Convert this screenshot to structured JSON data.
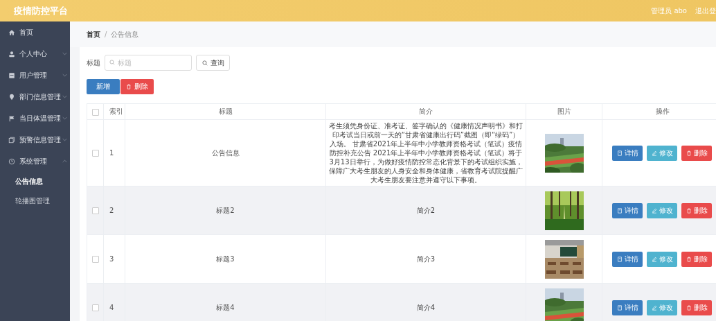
{
  "header": {
    "title": "疫情防控平台",
    "user": "管理员 abo",
    "logout": "退出登"
  },
  "sidebar": {
    "items": [
      {
        "label": "首页"
      },
      {
        "label": "个人中心",
        "expanded": false
      },
      {
        "label": "用户管理",
        "expanded": false
      },
      {
        "label": "部门信息管理",
        "expanded": false
      },
      {
        "label": "当日体温管理",
        "expanded": false
      },
      {
        "label": "预警信息管理",
        "expanded": false
      },
      {
        "label": "系统管理",
        "expanded": true,
        "children": [
          {
            "label": "公告信息",
            "selected": true
          },
          {
            "label": "轮播图管理",
            "selected": false
          }
        ]
      }
    ]
  },
  "breadcrumb": {
    "separator": "/",
    "items": [
      "首页",
      "公告信息"
    ]
  },
  "search": {
    "label": "标题",
    "placeholder": "标题",
    "button": "查询"
  },
  "toolbar": [
    {
      "kind": "primary",
      "label": "新增"
    },
    {
      "kind": "danger",
      "label": "删除"
    }
  ],
  "table": {
    "all_checked": false,
    "columns": [
      "索引",
      "标题",
      "简介",
      "图片",
      "操作"
    ],
    "rows": [
      {
        "checked": false,
        "index": "1",
        "title": "公告信息",
        "intro": "考生须凭身份证、准考证、签字确认的《健康情况声明书》和打印考试当日或前一天的“甘肃省健康出行码”截图（即“绿码”）入场。 甘肃省2021年上半年中小学教师资格考试（笔试）疫情防控补充公告 2021年上半年中小学教师资格考试（笔试）将于3月13日举行，为做好疫情防控常态化背景下的考试组织实施，保障广大考生朋友的人身安全和身体健康，省教育考试院提醒广大考生朋友要注意并遵守以下事项。",
        "actions": [
          {
            "kind": "primary",
            "label": "详情"
          },
          {
            "kind": "info",
            "label": "修改"
          },
          {
            "kind": "danger",
            "label": "删除"
          }
        ]
      },
      {
        "checked": false,
        "index": "2",
        "title": "标题2",
        "intro": "简介2",
        "actions": [
          {
            "kind": "primary",
            "label": "详情"
          },
          {
            "kind": "info",
            "label": "修改"
          },
          {
            "kind": "danger",
            "label": "删除"
          }
        ]
      },
      {
        "checked": false,
        "index": "3",
        "title": "标题3",
        "intro": "简介3",
        "actions": [
          {
            "kind": "primary",
            "label": "详情"
          },
          {
            "kind": "info",
            "label": "修改"
          },
          {
            "kind": "danger",
            "label": "删除"
          }
        ]
      },
      {
        "checked": false,
        "index": "4",
        "title": "标题4",
        "intro": "简介4",
        "actions": [
          {
            "kind": "primary",
            "label": "详情"
          },
          {
            "kind": "info",
            "label": "修改"
          },
          {
            "kind": "danger",
            "label": "删除"
          }
        ]
      }
    ]
  }
}
